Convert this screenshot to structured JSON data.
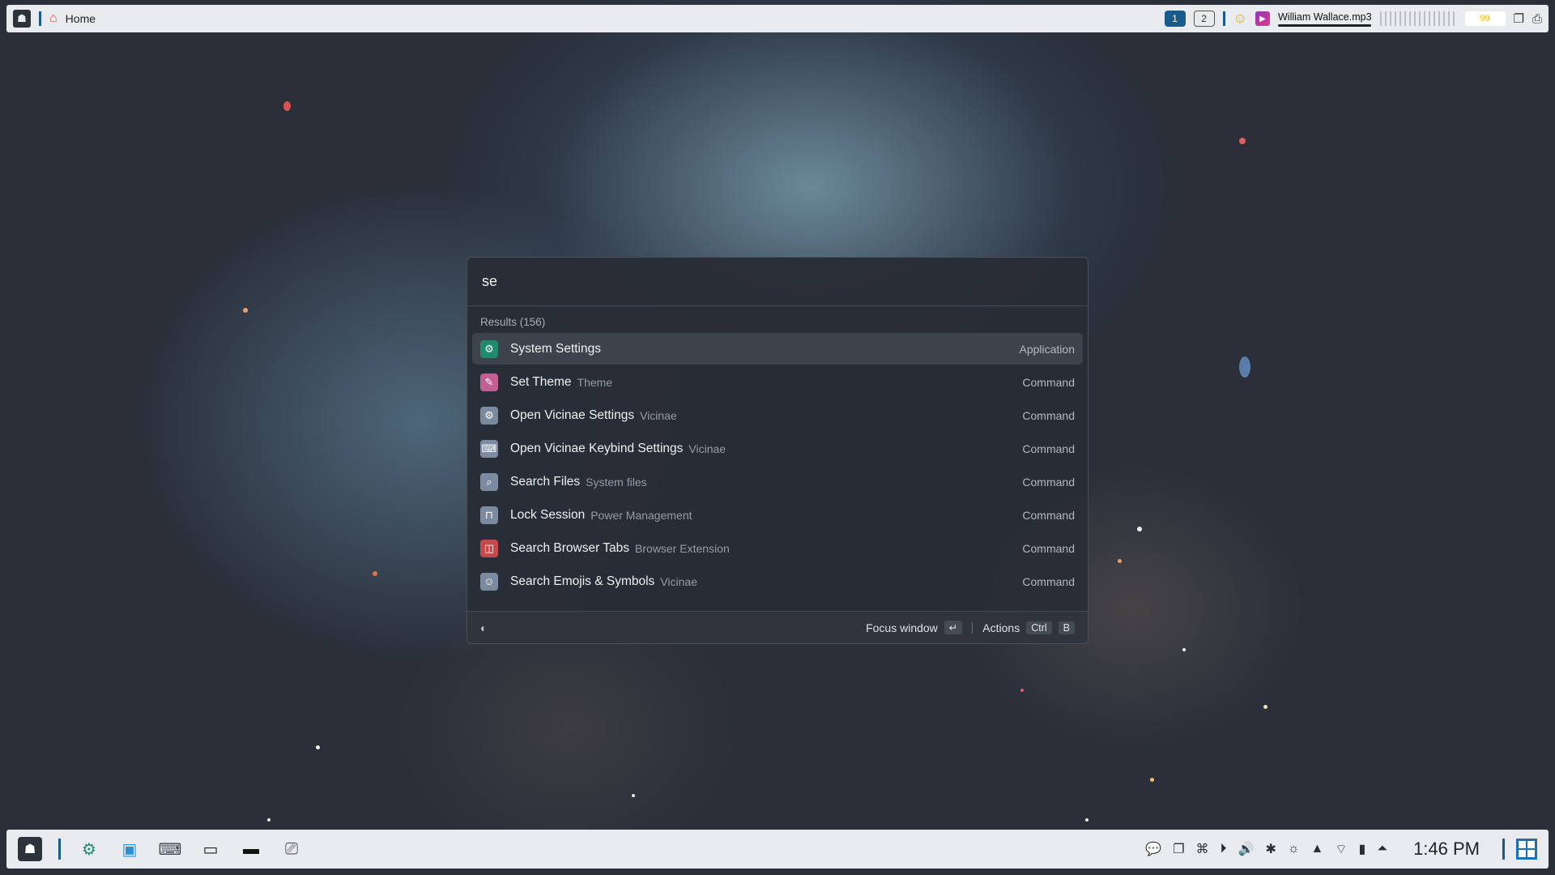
{
  "top_panel": {
    "home_label": "Home",
    "workspaces": [
      "1",
      "2"
    ],
    "media_title": "William Wallace.mp3",
    "temp_value": "99"
  },
  "launcher": {
    "search_value": "se",
    "results_header": "Results (156)",
    "results": [
      {
        "title": "System Settings",
        "subtitle": "",
        "type": "Application",
        "icon": "settings-app-icon",
        "color": "#1f8a6e"
      },
      {
        "title": "Set Theme",
        "subtitle": "Theme",
        "type": "Command",
        "icon": "brush-icon",
        "color": "#c25f95"
      },
      {
        "title": "Open Vicinae Settings",
        "subtitle": "Vicinae",
        "type": "Command",
        "icon": "gear-icon",
        "color": "#7b8a9e"
      },
      {
        "title": "Open Vicinae Keybind Settings",
        "subtitle": "Vicinae",
        "type": "Command",
        "icon": "keyboard-icon",
        "color": "#7b8a9e"
      },
      {
        "title": "Search Files",
        "subtitle": "System files",
        "type": "Command",
        "icon": "search-icon",
        "color": "#7b8a9e"
      },
      {
        "title": "Lock Session",
        "subtitle": "Power Management",
        "type": "Command",
        "icon": "lock-icon",
        "color": "#7b8a9e"
      },
      {
        "title": "Search Browser Tabs",
        "subtitle": "Browser Extension",
        "type": "Command",
        "icon": "browser-tabs-icon",
        "color": "#c9484a"
      },
      {
        "title": "Search Emojis & Symbols",
        "subtitle": "Vicinae",
        "type": "Command",
        "icon": "emoji-icon",
        "color": "#7b8a9e"
      }
    ],
    "footer": {
      "focus_label": "Focus window",
      "enter_key": "↵",
      "actions_label": "Actions",
      "ctrl_key": "Ctrl",
      "b_key": "B"
    }
  },
  "taskbar": {
    "clock": "1:46 PM"
  }
}
